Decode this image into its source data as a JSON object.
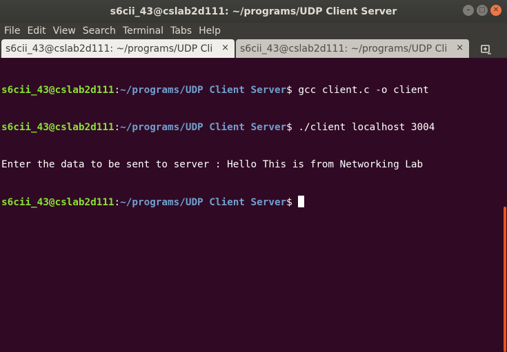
{
  "window": {
    "title": "s6cii_43@cslab2d111: ~/programs/UDP Client Server",
    "buttons": {
      "minimize": "–",
      "maximize": "□",
      "close": "✕"
    }
  },
  "menu": [
    "File",
    "Edit",
    "View",
    "Search",
    "Terminal",
    "Tabs",
    "Help"
  ],
  "tabs": [
    {
      "label": "s6cii_43@cslab2d111: ~/programs/UDP Cli...",
      "close": "×",
      "active": true
    },
    {
      "label": "s6cii_43@cslab2d111: ~/programs/UDP Cli...",
      "close": "×",
      "active": false
    }
  ],
  "new_tab_icon": "new-tab-icon",
  "terminal": {
    "prompt_user": "s6cii_43@cslab2d111",
    "prompt_path": "~/programs/UDP Client Server",
    "lines": [
      {
        "command": " gcc client.c -o client"
      },
      {
        "command": " ./client localhost 3004"
      },
      {
        "output": "Enter the data to be sent to server : Hello This is from Networking Lab"
      }
    ]
  },
  "colors": {
    "background": "#300a24",
    "prompt_user": "#8ae234",
    "prompt_path": "#729fcf",
    "scroll_thumb": "#e95420"
  }
}
